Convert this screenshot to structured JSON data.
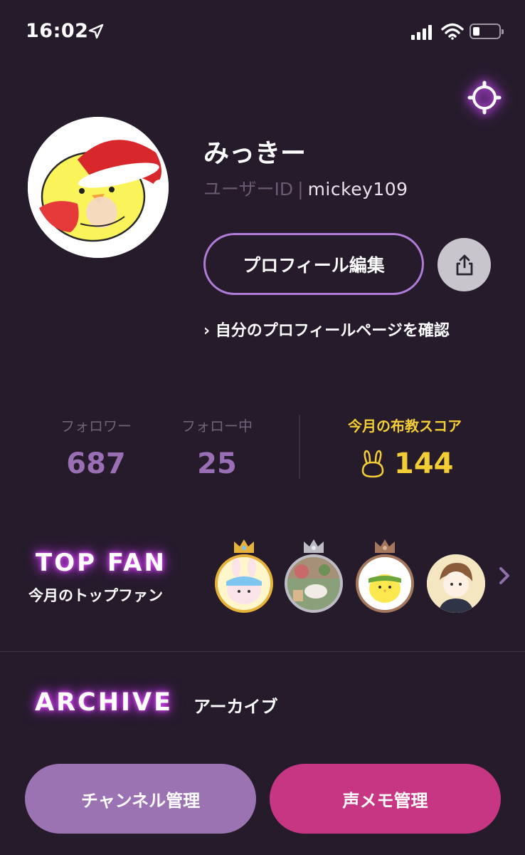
{
  "status_bar": {
    "time": "16:02"
  },
  "profile": {
    "name": "みっきー",
    "user_id_label": "ユーザーID",
    "separator": "|",
    "user_id": "mickey109",
    "edit_label": "プロフィール編集",
    "view_link": "› 自分のプロフィールページを確認"
  },
  "stats": {
    "followers_label": "フォロワー",
    "followers": "687",
    "following_label": "フォロー中",
    "following": "25",
    "score_label": "今月の布教スコア",
    "score": "144"
  },
  "top_fan": {
    "title": "TOP FAN",
    "subtitle": "今月のトップファン",
    "crowns": [
      "gold",
      "silver",
      "bronze"
    ]
  },
  "archive": {
    "title": "ARCHIVE",
    "subtitle": "アーカイブ"
  },
  "buttons": {
    "channel": "チャンネル管理",
    "memo": "声メモ管理"
  },
  "colors": {
    "background": "#251b2b",
    "accent_purple": "#9b72b2",
    "accent_pink": "#c63682",
    "score_yellow": "#f3cd35",
    "neon": "#d24cff"
  }
}
